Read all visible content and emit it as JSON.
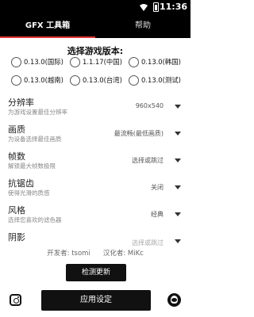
{
  "status_bar": {
    "time": "11:36"
  },
  "tabs": [
    {
      "label": "GFX 工具箱",
      "active": true
    },
    {
      "label": "帮助",
      "active": false
    }
  ],
  "version_section": {
    "title": "选择游戏版本:",
    "options": [
      "0.13.0(国际)",
      "1.1.17(中国)",
      "0.13.0(韩国)",
      "0.13.0(越南)",
      "0.13.0(台湾)",
      "0.13.0(测试)"
    ]
  },
  "settings": [
    {
      "title": "分辨率",
      "description": "为游戏设置最佳分辨率",
      "value": "960x540"
    },
    {
      "title": "画质",
      "description": "为设备选择最佳画质",
      "value": "最流畅(最低画质)"
    },
    {
      "title": "帧数",
      "description": "解锁最大帧数极限",
      "value": "选择或跳过"
    },
    {
      "title": "抗锯齿",
      "description": "使得光滑的质感",
      "value": "关闭"
    },
    {
      "title": "风格",
      "description": "选择您喜欢的滤色器",
      "value": "经典"
    },
    {
      "title": "阴影",
      "description": "",
      "value": "选择或跳过"
    }
  ],
  "credits": {
    "developer": "开发者: tsomi",
    "translator": "汉化者: MiKc"
  },
  "buttons": {
    "check_update": "检测更新",
    "apply": "应用设定"
  },
  "icons": {
    "left_footer": "instagram-icon",
    "right_footer": "qq-icon",
    "status_wifi": "wifi-icon",
    "status_battery": "battery-icon"
  },
  "colors": {
    "accent": "#e53935",
    "bar_background": "#000000"
  }
}
